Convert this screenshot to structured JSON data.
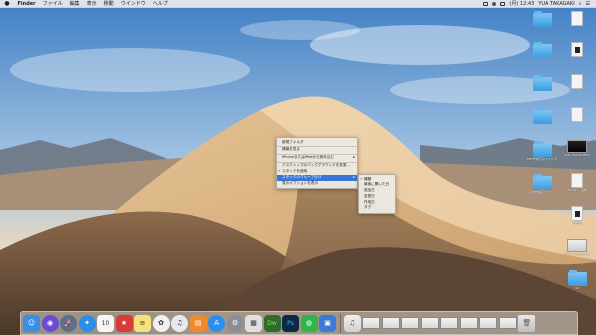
{
  "menubar": {
    "app": "Finder",
    "items": [
      "ファイル",
      "編集",
      "表示",
      "移動",
      "ウインドウ",
      "ヘルプ"
    ],
    "clock": "(月) 12:43",
    "user": "YUA TAKAGAKI"
  },
  "desktop_icons": [
    {
      "label": ""
    },
    {
      "label": ""
    },
    {
      "label": ""
    },
    {
      "label": ""
    },
    {
      "label": ""
    },
    {
      "label": ""
    },
    {
      "label": ""
    },
    {
      "label": ""
    },
    {
      "label": ""
    },
    {
      "label": "PDF作成済みフォルダ"
    },
    {
      "label": "SNS_IMAGE.MOV"
    },
    {
      "label": "名前未設定フォルダ"
    },
    {
      "label": "IMG_0 ... 画像"
    },
    {
      "label": "その他"
    },
    {
      "label": "スクリーンショット"
    },
    {
      "label": "3D"
    }
  ],
  "context_menu": {
    "items": [
      {
        "label": "新規フォルダ"
      },
      {
        "label": "情報を見る"
      },
      {
        "label": "iPhoneまたはiPadから読み込む"
      },
      {
        "label": "デスクトップのバックグラウンドを変更..."
      },
      {
        "label": "スタックを使用"
      },
      {
        "label": "スタックのグループ分け"
      },
      {
        "label": "表示オプションを表示"
      }
    ]
  },
  "submenu": {
    "items": [
      {
        "label": "種類"
      },
      {
        "label": "最後に開いた日"
      },
      {
        "label": "追加日"
      },
      {
        "label": "変更日"
      },
      {
        "label": "作成日"
      },
      {
        "label": "タグ"
      }
    ]
  },
  "dock": {
    "apps": [
      {
        "name": "finder-icon",
        "glyph": "☺",
        "color": "#3b8ee0"
      },
      {
        "name": "siri-icon",
        "glyph": "◉",
        "color": "#6a4bd6"
      },
      {
        "name": "launchpad-icon",
        "glyph": "🚀",
        "color": "#5b6f88"
      },
      {
        "name": "safari-icon",
        "glyph": "✦",
        "color": "#2d8ee8"
      },
      {
        "name": "calendar-icon",
        "glyph": "10",
        "color": "#f7f7f7"
      },
      {
        "name": "bookmark-app-icon",
        "glyph": "★",
        "color": "#d93a3a"
      },
      {
        "name": "notes-icon",
        "glyph": "≡",
        "color": "#f5e27a"
      },
      {
        "name": "photos-icon",
        "glyph": "✿",
        "color": "#f0f0f0"
      },
      {
        "name": "itunes-icon",
        "glyph": "♫",
        "color": "#e8e8ee"
      },
      {
        "name": "books-icon",
        "glyph": "▤",
        "color": "#f08a2a"
      },
      {
        "name": "app-store-icon",
        "glyph": "A",
        "color": "#2b8ef0"
      },
      {
        "name": "system-preferences-icon",
        "glyph": "⚙",
        "color": "#8a8f96"
      },
      {
        "name": "preview-icon",
        "glyph": "▦",
        "color": "#e0e0e0"
      },
      {
        "name": "dreamweaver-icon",
        "glyph": "Dw",
        "color": "#2f6b2a"
      },
      {
        "name": "photoshop-icon",
        "glyph": "Ps",
        "color": "#0d2a44"
      },
      {
        "name": "line-icon",
        "glyph": "◍",
        "color": "#2fb54a"
      },
      {
        "name": "image-viewer-icon",
        "glyph": "▣",
        "color": "#3b7ad6"
      }
    ],
    "docs": [
      {
        "name": "music-folder-icon",
        "glyph": "♫"
      },
      {
        "name": "screenshot-doc-1-icon",
        "glyph": ""
      },
      {
        "name": "screenshot-doc-2-icon",
        "glyph": ""
      },
      {
        "name": "screenshot-doc-3-icon",
        "glyph": ""
      },
      {
        "name": "screenshot-doc-4-icon",
        "glyph": ""
      },
      {
        "name": "screenshot-doc-5-icon",
        "glyph": ""
      },
      {
        "name": "screenshot-doc-6-icon",
        "glyph": ""
      },
      {
        "name": "screenshot-doc-7-icon",
        "glyph": ""
      },
      {
        "name": "screenshot-doc-8-icon",
        "glyph": ""
      },
      {
        "name": "trash-icon",
        "glyph": "🗑"
      }
    ]
  }
}
